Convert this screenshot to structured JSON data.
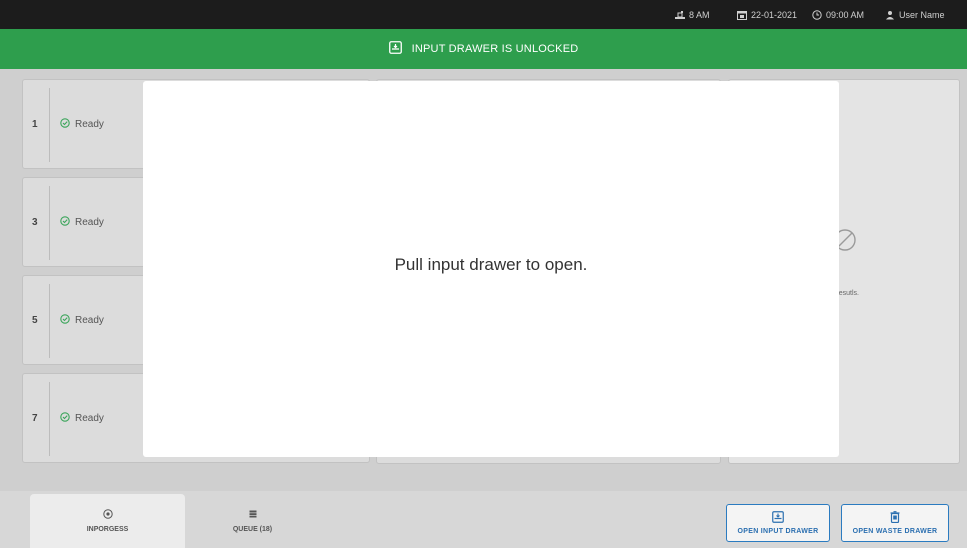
{
  "topbar": {
    "level": "8 AM",
    "date": "22-01-2021",
    "time": "09:00 AM",
    "user": "User Name",
    "icons": [
      "level-icon",
      "calendar-icon",
      "clock-icon",
      "user-icon"
    ]
  },
  "banner": {
    "text": "INPUT DRAWER IS UNLOCKED",
    "icon": "drawer-icon"
  },
  "slots": [
    {
      "number": "1",
      "status": "Ready"
    },
    {
      "number": "3",
      "status": "Ready"
    },
    {
      "number": "5",
      "status": "Ready"
    },
    {
      "number": "7",
      "status": "Ready"
    }
  ],
  "right_panel": {
    "message": "it resutls.",
    "icon": "no-results-icon"
  },
  "modal": {
    "text": "Pull input drawer to open."
  },
  "tabs": {
    "inprogress": "INPORGESS",
    "queue": "QUEUE (18)"
  },
  "buttons": {
    "open_input": "OPEN INPUT DRAWER",
    "open_waste": "OPEN WASTE DRAWER"
  },
  "colors": {
    "banner_green": "#2e9e4d",
    "ready_green": "#3aa55a",
    "button_blue": "#2b7bc0",
    "topbar": "#1c1c1c"
  }
}
